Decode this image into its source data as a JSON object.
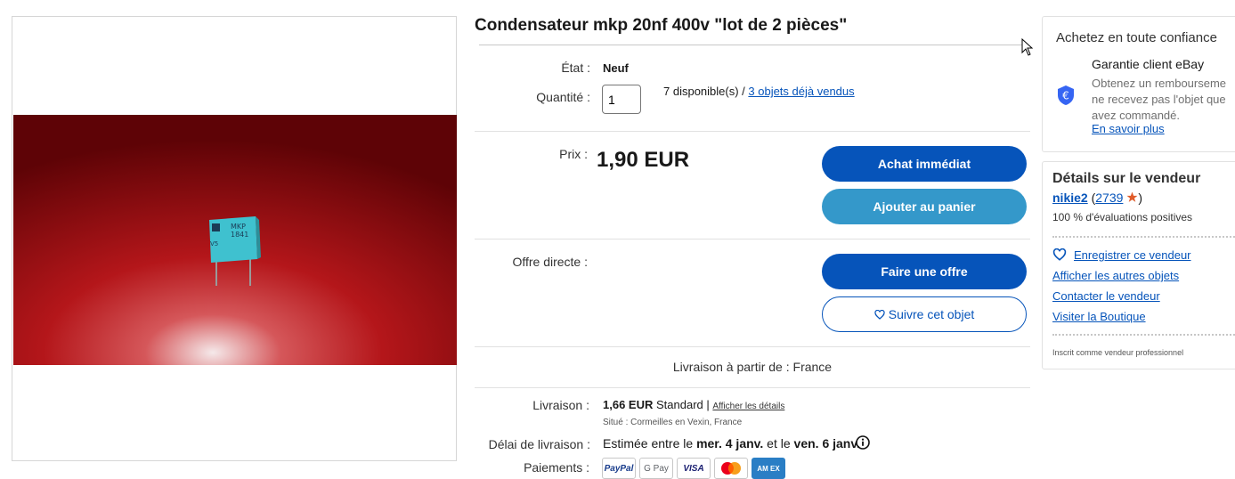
{
  "listing": {
    "title": "Condensateur mkp 20nf 400v \"lot de 2 pièces\"",
    "condition_label": "État :",
    "condition_value": "Neuf",
    "quantity_label": "Quantité :",
    "quantity_value": "1",
    "available": "7 disponible(s) / ",
    "sold_link": "3 objets déjà vendus",
    "price_label": "Prix :",
    "price": "1,90 EUR",
    "buy_now": "Achat immédiat",
    "add_to_cart": "Ajouter au panier",
    "best_offer_label": "Offre directe :",
    "make_offer": "Faire une offre",
    "watch": "Suivre cet objet",
    "ships_from": "Livraison à partir de : France",
    "shipping_label": "Livraison :",
    "shipping_cost": "1,66 EUR",
    "shipping_method": " Standard | ",
    "shipping_details_link": "Afficher les détails",
    "located": "Situé : Cormeilles en Vexin, France",
    "delivery_label": "Délai de livraison :",
    "delivery_pre": "Estimée entre le ",
    "delivery_from": "mer. 4 janv.",
    "delivery_mid": " et le ",
    "delivery_to": "ven. 6 janv.",
    "payments_label": "Paiements :",
    "payment_methods": [
      "PayPal",
      "G Pay",
      "VISA",
      "Mastercard",
      "AM EX"
    ]
  },
  "product_image": {
    "print_brand": "MKP",
    "print_code": "1841",
    "print_grade": "V5"
  },
  "guarantee": {
    "heading": "Achetez en toute confiance",
    "title": "Garantie client eBay",
    "text_line1": "Obtenez un rembourseme",
    "text_line2": "ne recevez pas l'objet que",
    "text_line3": "avez commandé.",
    "learn_more": "En savoir plus",
    "icon": "euro-shield-icon"
  },
  "seller": {
    "heading": "Détails sur le vendeur",
    "name": "nikie2",
    "feedback_open": " (",
    "feedback_score": "2739",
    "feedback_close": ")",
    "positive": "100 % d'évaluations positives",
    "save_seller": "Enregistrer ce vendeur",
    "other_items": "Afficher les autres objets",
    "contact": "Contacter le vendeur",
    "store": "Visiter la Boutique",
    "registered": "Inscrit comme vendeur professionnel"
  },
  "colors": {
    "primary_button": "#0654ba",
    "secondary_button": "#3498ca",
    "link": "#0654ba",
    "star": "#e05c2a",
    "photo_red": "#b4161a"
  }
}
